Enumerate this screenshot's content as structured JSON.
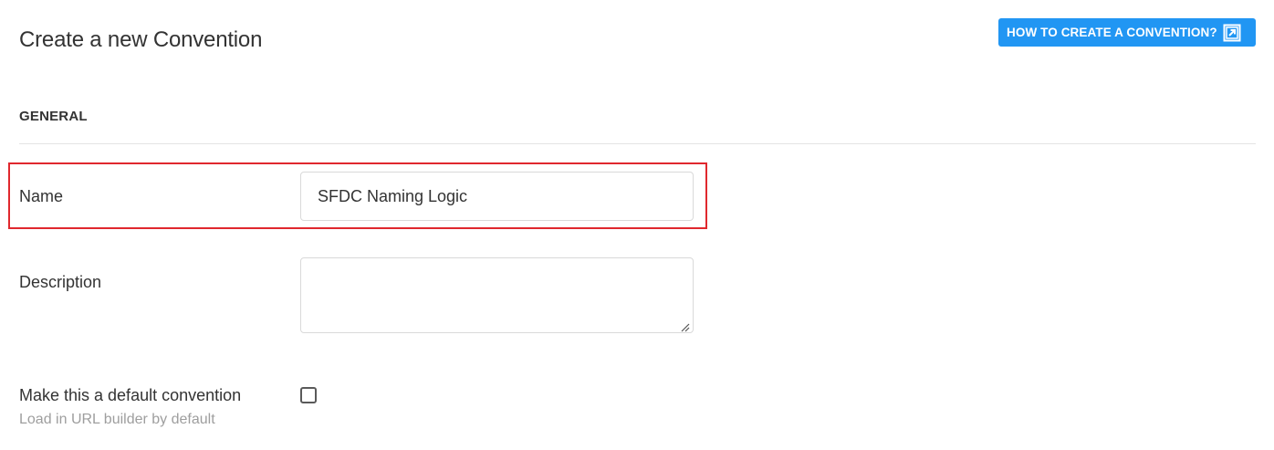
{
  "page": {
    "title": "Create a new Convention",
    "help_button_label": "HOW TO CREATE A CONVENTION?"
  },
  "section": {
    "heading": "GENERAL"
  },
  "form": {
    "name": {
      "label": "Name",
      "value": "SFDC Naming Logic"
    },
    "description": {
      "label": "Description",
      "value": ""
    },
    "default_convention": {
      "label": "Make this a default convention",
      "hint": "Load in URL builder by default",
      "checked": false
    }
  },
  "colors": {
    "accent": "#2196f3",
    "highlight": "#e0282e",
    "hint_text": "#9e9e9e"
  },
  "icons": {
    "help_button": "external-link-icon",
    "textarea": "resize-handle-icon"
  }
}
